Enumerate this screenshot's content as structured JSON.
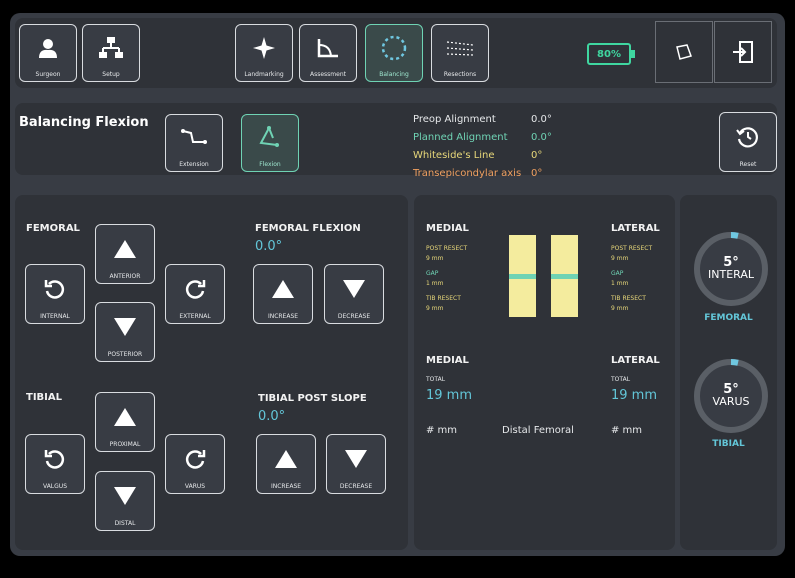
{
  "nav": {
    "surgeon": "Surgeon",
    "setup": "Setup",
    "landmarking": "Landmarking",
    "assessment": "Assessment",
    "balancing": "Balancing",
    "resections": "Resections",
    "battery": "80%"
  },
  "header": {
    "title": "Balancing Flexion",
    "extension": "Extension",
    "flexion": "Flexion",
    "reset": "Reset",
    "alignment": [
      {
        "label": "Preop Alignment",
        "value": "0.0°",
        "color": "#e6e8ea"
      },
      {
        "label": "Planned Alignment",
        "value": "0.0°",
        "color": "#6fd3b4"
      },
      {
        "label": "Whiteside's Line",
        "value": "0°",
        "color": "#e8d87a"
      },
      {
        "label": "Transepicondylar axis",
        "value": "0°",
        "color": "#f0a060"
      }
    ]
  },
  "femoral": {
    "title": "FEMORAL",
    "anterior": "ANTERIOR",
    "posterior": "POSTERIOR",
    "internal": "INTERNAL",
    "external": "EXTERNAL",
    "flexion_title": "FEMORAL FLEXION",
    "flexion_value": "0.0°",
    "increase": "INCREASE",
    "decrease": "DECREASE"
  },
  "tibial": {
    "title": "TIBIAL",
    "proximal": "PROXIMAL",
    "distal": "DISTAL",
    "valgus": "VALGUS",
    "varus": "VARUS",
    "slope_title": "TIBIAL POST SLOPE",
    "slope_value": "0.0°",
    "increase": "INCREASE",
    "decrease": "DECREASE"
  },
  "gap": {
    "medial": "MEDIAL",
    "lateral": "LATERAL",
    "post_resect": "POST RESECT",
    "gap": "GAP",
    "tib_resect": "TIB RESECT",
    "medial_post": "9 mm",
    "medial_gap": "1 mm",
    "medial_tib": "9 mm",
    "lateral_post": "9 mm",
    "lateral_gap": "1 mm",
    "lateral_tib": "9 mm",
    "total": "TOTAL",
    "medial_total": "19 mm",
    "lateral_total": "19 mm",
    "medial_hash": "# mm",
    "lateral_hash": "# mm",
    "distal_femoral": "Distal Femoral"
  },
  "gauges": {
    "femoral_value": "5°",
    "femoral_sub": "INTERAL",
    "femoral_label": "FEMORAL",
    "tibial_value": "5°",
    "tibial_sub": "VARUS",
    "tibial_label": "TIBIAL"
  }
}
